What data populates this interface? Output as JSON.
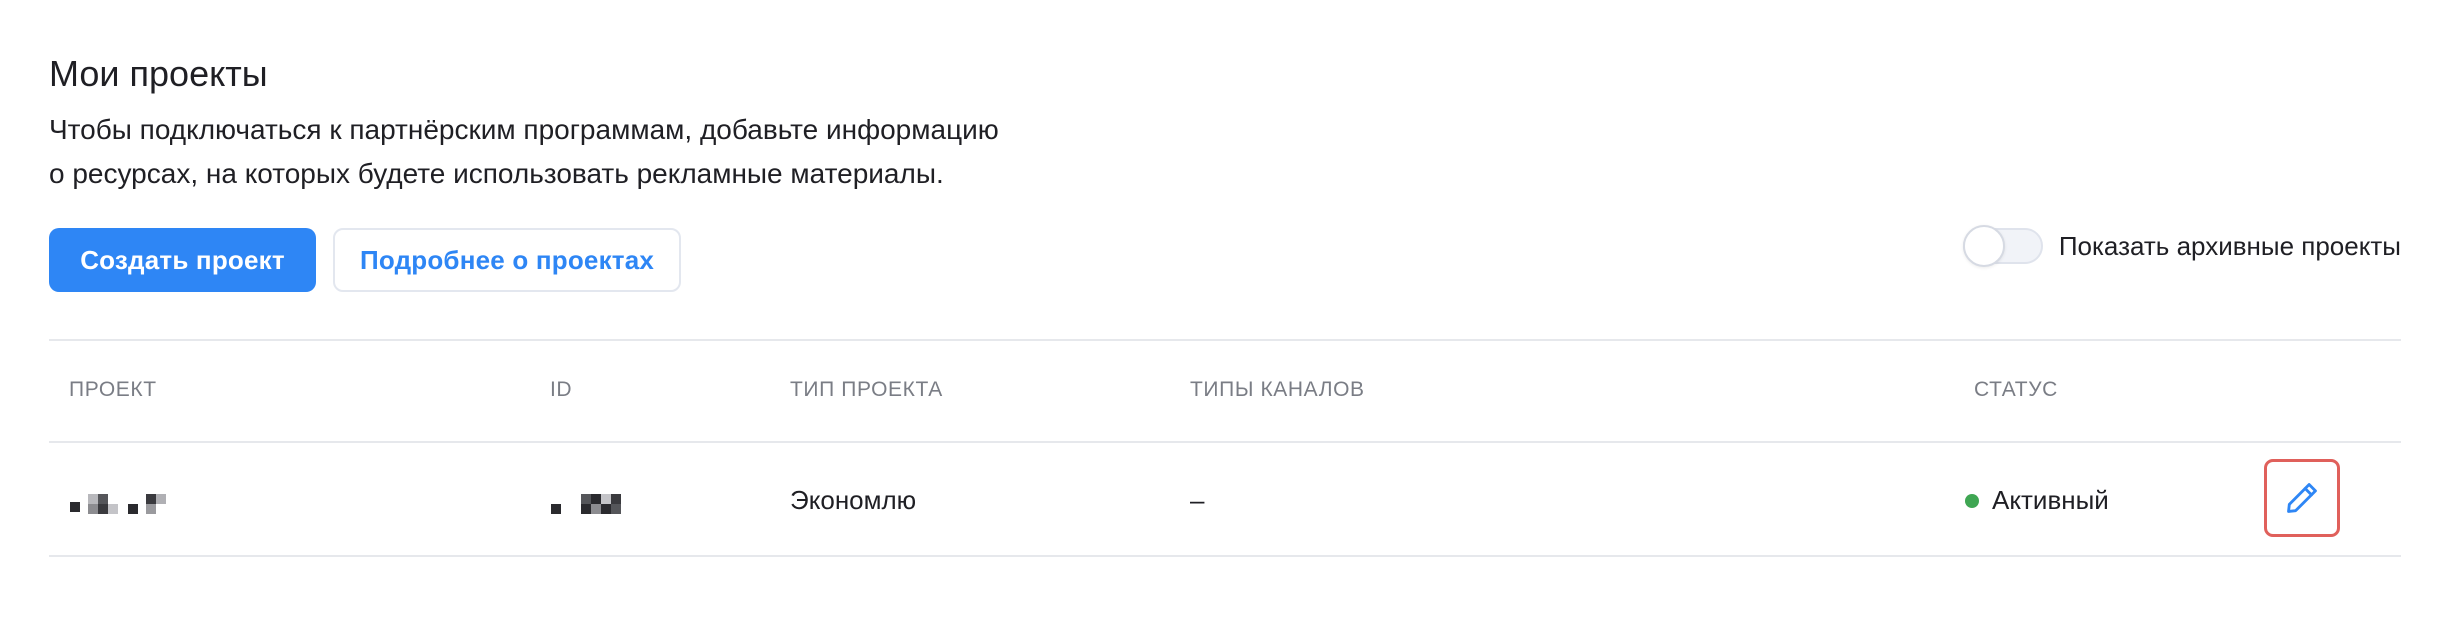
{
  "header": {
    "title": "Мои проекты",
    "description_line1": "Чтобы подключаться к партнёрским программам, добавьте информацию",
    "description_line2": "о ресурсах, на которых будете использовать рекламные материалы."
  },
  "actions": {
    "create_label": "Создать проект",
    "more_label": "Подробнее о проектах"
  },
  "archive_toggle": {
    "label": "Показать архивные проекты",
    "checked": false
  },
  "table": {
    "columns": [
      "ПРОЕКТ",
      "ID",
      "ТИП ПРОЕКТА",
      "ТИПЫ КАНАЛОВ",
      "СТАТУС"
    ],
    "rows": [
      {
        "project": "",
        "id": "",
        "type": "Экономлю",
        "channels": "–",
        "status": "Активный",
        "status_color": "#3fa653",
        "action_icon": "pencil-icon"
      }
    ]
  },
  "colors": {
    "accent": "#2e86f5",
    "status_active": "#3fa653",
    "highlight": "#e0605b"
  }
}
